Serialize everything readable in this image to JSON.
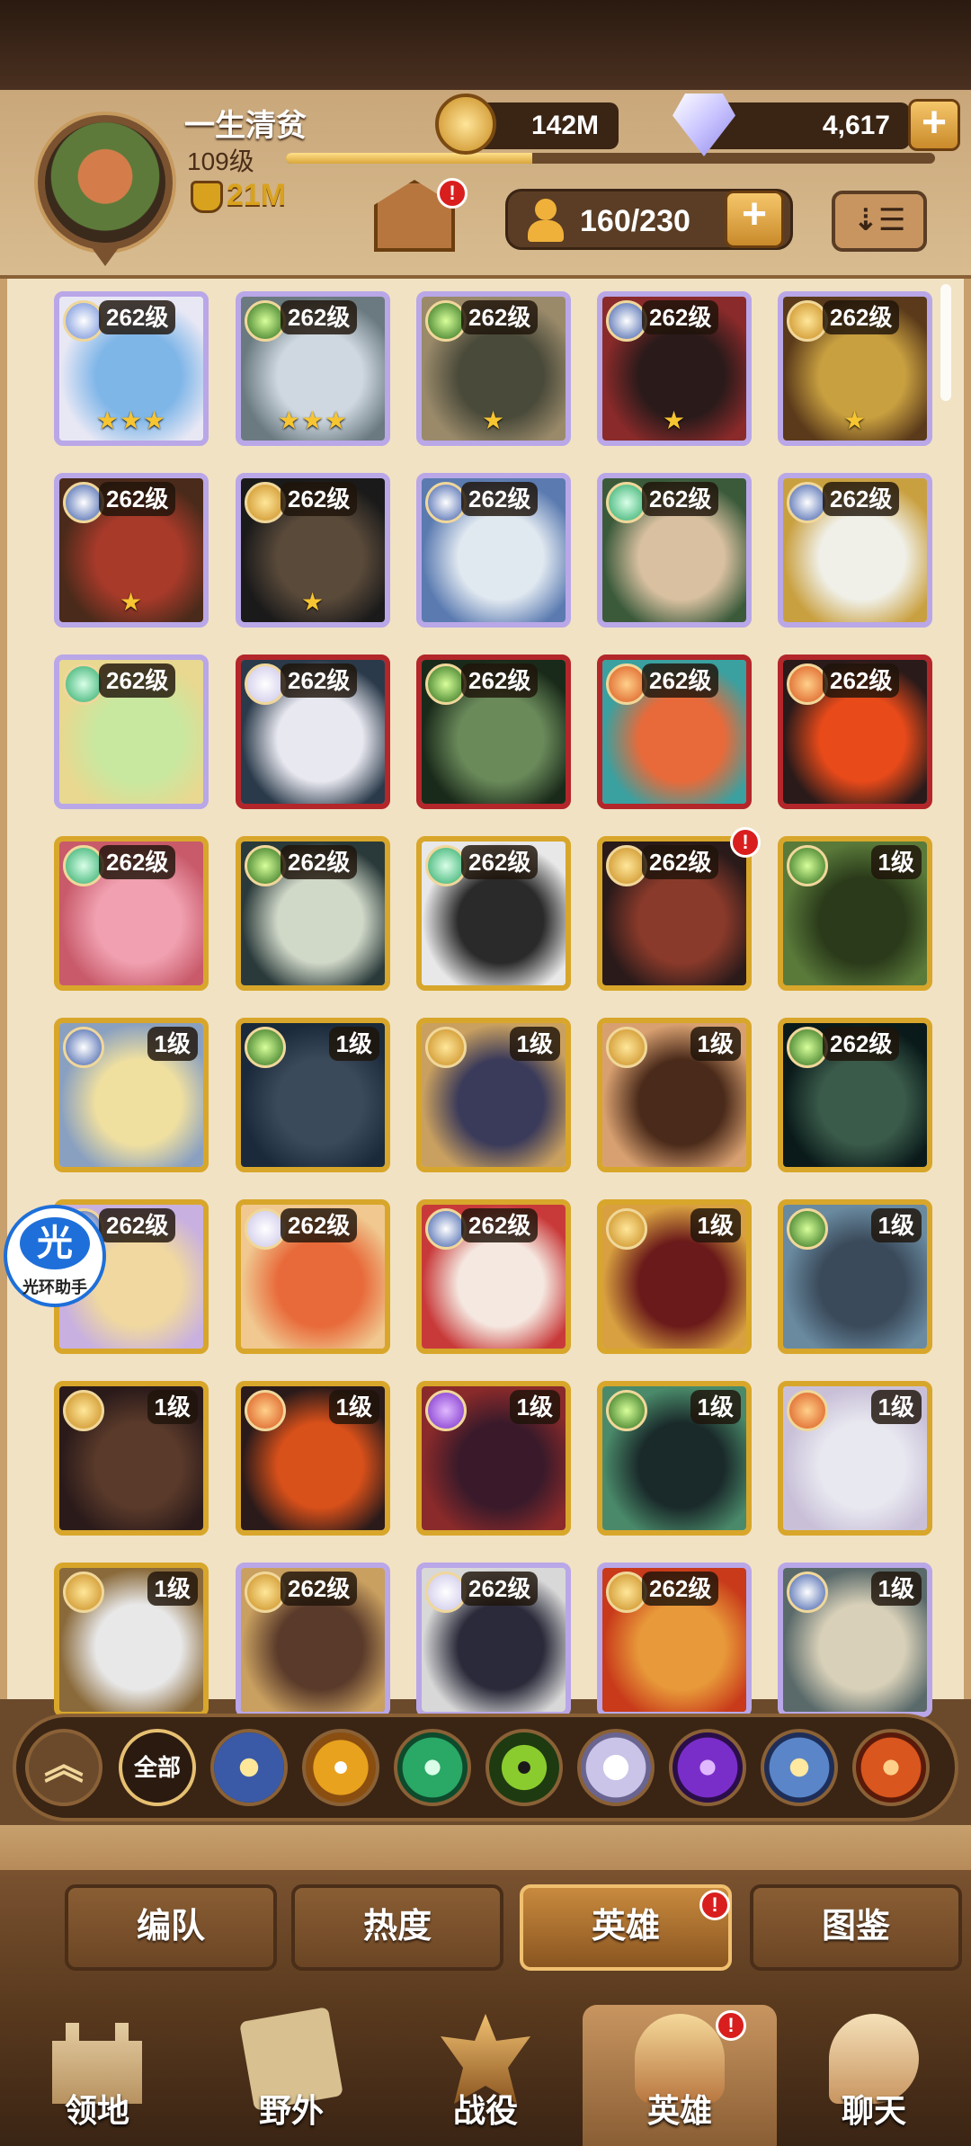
{
  "player": {
    "name": "一生清贫",
    "level": "109级",
    "power": "21M",
    "xp_fraction": 0.38
  },
  "currency": {
    "gold": "142M",
    "gems": "4,617"
  },
  "hero_count": "160/230",
  "alert": "!",
  "heroes": [
    {
      "level": "262级",
      "stars": "★★★",
      "frame": "purple"
    },
    {
      "level": "262级",
      "stars": "★★★",
      "frame": "purple"
    },
    {
      "level": "262级",
      "stars": "★",
      "frame": "purple"
    },
    {
      "level": "262级",
      "stars": "★",
      "frame": "purple"
    },
    {
      "level": "262级",
      "stars": "★",
      "frame": "purple"
    },
    {
      "level": "262级",
      "stars": "★",
      "frame": "purple"
    },
    {
      "level": "262级",
      "stars": "★",
      "frame": "purple"
    },
    {
      "level": "262级",
      "stars": "",
      "frame": "purple"
    },
    {
      "level": "262级",
      "stars": "",
      "frame": "purple"
    },
    {
      "level": "262级",
      "stars": "",
      "frame": "purple"
    },
    {
      "level": "262级",
      "stars": "",
      "frame": "purple"
    },
    {
      "level": "262级",
      "stars": "",
      "frame": "red"
    },
    {
      "level": "262级",
      "stars": "",
      "frame": "red"
    },
    {
      "level": "262级",
      "stars": "",
      "frame": "red"
    },
    {
      "level": "262级",
      "stars": "",
      "frame": "red"
    },
    {
      "level": "262级",
      "stars": "",
      "frame": "gold"
    },
    {
      "level": "262级",
      "stars": "",
      "frame": "gold"
    },
    {
      "level": "262级",
      "stars": "",
      "frame": "gold"
    },
    {
      "level": "262级",
      "stars": "",
      "frame": "gold",
      "alert": true
    },
    {
      "level": "1级",
      "stars": "",
      "frame": "gold"
    },
    {
      "level": "1级",
      "stars": "",
      "frame": "gold"
    },
    {
      "level": "1级",
      "stars": "",
      "frame": "gold"
    },
    {
      "level": "1级",
      "stars": "",
      "frame": "gold"
    },
    {
      "level": "1级",
      "stars": "",
      "frame": "gold"
    },
    {
      "level": "262级",
      "stars": "",
      "frame": "gold"
    },
    {
      "level": "262级",
      "stars": "",
      "frame": "gold"
    },
    {
      "level": "262级",
      "stars": "",
      "frame": "gold"
    },
    {
      "level": "262级",
      "stars": "",
      "frame": "gold"
    },
    {
      "level": "1级",
      "stars": "",
      "frame": "gold"
    },
    {
      "level": "1级",
      "stars": "",
      "frame": "gold"
    },
    {
      "level": "1级",
      "stars": "",
      "frame": "gold"
    },
    {
      "level": "1级",
      "stars": "",
      "frame": "gold"
    },
    {
      "level": "1级",
      "stars": "",
      "frame": "gold"
    },
    {
      "level": "1级",
      "stars": "",
      "frame": "gold"
    },
    {
      "level": "1级",
      "stars": "",
      "frame": "gold"
    },
    {
      "level": "1级",
      "stars": "",
      "frame": "gold"
    },
    {
      "level": "262级",
      "stars": "",
      "frame": "purple"
    },
    {
      "level": "262级",
      "stars": "",
      "frame": "purple"
    },
    {
      "level": "262级",
      "stars": "",
      "frame": "purple"
    },
    {
      "level": "1级",
      "stars": "",
      "frame": "purple"
    }
  ],
  "assistant": {
    "icon_text": "光",
    "label": "光环助手"
  },
  "filter": {
    "all_label": "全部"
  },
  "tabs": [
    "编队",
    "热度",
    "英雄",
    "图鉴"
  ],
  "nav": [
    "领地",
    "野外",
    "战役",
    "英雄",
    "聊天"
  ],
  "colors": {
    "accent": "#d9a21e",
    "alert": "#d91e1e"
  }
}
